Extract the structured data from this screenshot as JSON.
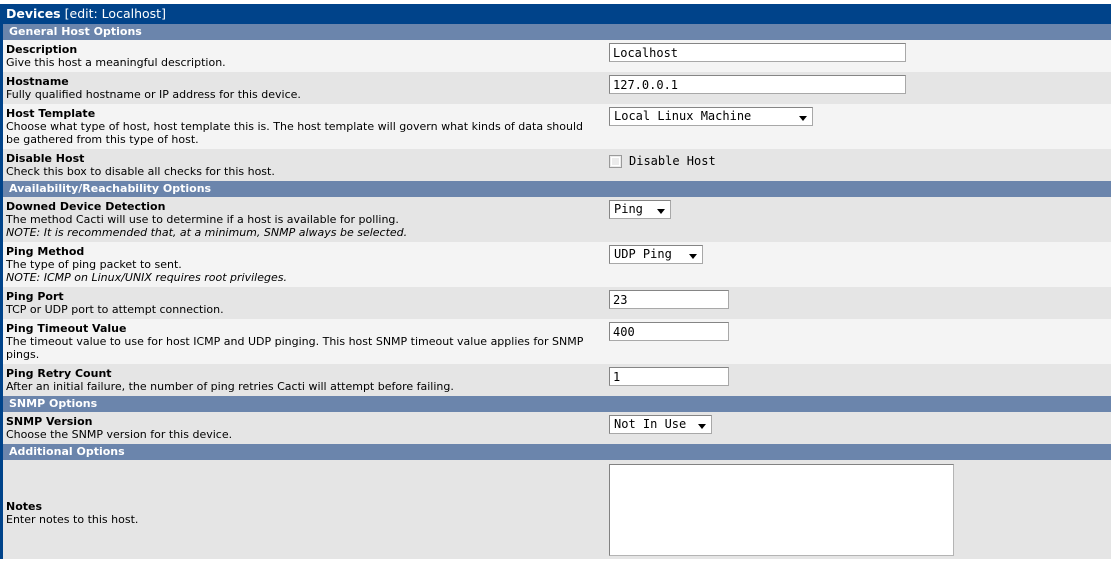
{
  "title_bar": {
    "main": "Devices",
    "sub": "[edit: Localhost]"
  },
  "sections": {
    "general": "General Host Options",
    "availability": "Availability/Reachability Options",
    "snmp": "SNMP Options",
    "additional": "Additional Options"
  },
  "fields": {
    "description": {
      "label": "Description",
      "desc": "Give this host a meaningful description.",
      "value": "Localhost"
    },
    "hostname": {
      "label": "Hostname",
      "desc": "Fully qualified hostname or IP address for this device.",
      "value": "127.0.0.1"
    },
    "host_template": {
      "label": "Host Template",
      "desc": "Choose what type of host, host template this is. The host template will govern what kinds of data should be gathered from this type of host.",
      "value": "Local Linux Machine"
    },
    "disable_host": {
      "label": "Disable Host",
      "desc": "Check this box to disable all checks for this host.",
      "checkbox_label": "Disable Host",
      "checked": false
    },
    "downed_device_detection": {
      "label": "Downed Device Detection",
      "desc": "The method Cacti will use to determine if a host is available for polling.",
      "note": "NOTE: It is recommended that, at a minimum, SNMP always be selected.",
      "value": "Ping"
    },
    "ping_method": {
      "label": "Ping Method",
      "desc": "The type of ping packet to sent.",
      "note": "NOTE: ICMP on Linux/UNIX requires root privileges.",
      "value": "UDP Ping"
    },
    "ping_port": {
      "label": "Ping Port",
      "desc": "TCP or UDP port to attempt connection.",
      "value": "23"
    },
    "ping_timeout": {
      "label": "Ping Timeout Value",
      "desc": "The timeout value to use for host ICMP and UDP pinging. This host SNMP timeout value applies for SNMP pings.",
      "value": "400"
    },
    "ping_retry": {
      "label": "Ping Retry Count",
      "desc": "After an initial failure, the number of ping retries Cacti will attempt before failing.",
      "value": "1"
    },
    "snmp_version": {
      "label": "SNMP Version",
      "desc": "Choose the SNMP version for this device.",
      "value": "Not In Use"
    },
    "notes": {
      "label": "Notes",
      "desc": "Enter notes to this host.",
      "value": "",
      "placeholder": ""
    }
  },
  "colors": {
    "title_bar": "#00438a",
    "section_bar": "#6b85ac",
    "row_light": "#f4f4f4",
    "row_dark": "#e5e5e5",
    "text": "#000000"
  }
}
